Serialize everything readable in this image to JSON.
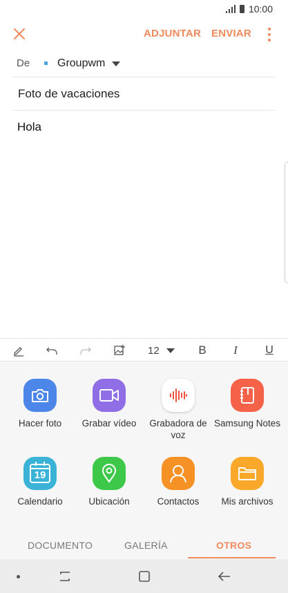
{
  "status_bar": {
    "time": "10:00",
    "icons": [
      "signal-icon",
      "battery-icon"
    ]
  },
  "header": {
    "close_icon": "close-icon",
    "attach_label": "ADJUNTAR",
    "send_label": "ENVIAR",
    "more_icon": "more-vertical-icon",
    "accent_color": "#f08a5d"
  },
  "compose": {
    "from_label": "De",
    "from_value": "Groupwm",
    "subject": "Foto de vacaciones",
    "body": "Hola"
  },
  "toolbar": {
    "icons": [
      "pen-icon",
      "undo-icon",
      "redo-icon",
      "insert-image-icon",
      "bold-icon",
      "italic-icon",
      "underline-icon"
    ],
    "font_size": "12",
    "bold_label": "B",
    "italic_label": "I",
    "underline_label": "U"
  },
  "attach_panel": {
    "items": [
      {
        "label": "Hacer foto",
        "icon": "camera-icon",
        "color": "#4c86e8"
      },
      {
        "label": "Grabar vídeo",
        "icon": "video-camera-icon",
        "color": "#8f6ee6"
      },
      {
        "label": "Grabadora de voz",
        "icon": "voice-recorder-icon",
        "color": "#ffffff"
      },
      {
        "label": "Samsung Notes",
        "icon": "notes-icon",
        "color": "#f4624a"
      },
      {
        "label": "Calendario",
        "icon": "calendar-icon",
        "color": "#3ab3d6",
        "calendar_day": "19"
      },
      {
        "label": "Ubicación",
        "icon": "location-icon",
        "color": "#3dc84a"
      },
      {
        "label": "Contactos",
        "icon": "contacts-icon",
        "color": "#f69126"
      },
      {
        "label": "Mis archivos",
        "icon": "folder-icon",
        "color": "#f9a82a"
      }
    ],
    "tabs": [
      {
        "label": "DOCUMENTO",
        "active": false
      },
      {
        "label": "GALERÍA",
        "active": false
      },
      {
        "label": "OTROS",
        "active": true
      }
    ]
  },
  "nav_bar": {
    "icons": [
      "dot-icon",
      "recent-apps-icon",
      "home-icon",
      "back-icon"
    ]
  }
}
